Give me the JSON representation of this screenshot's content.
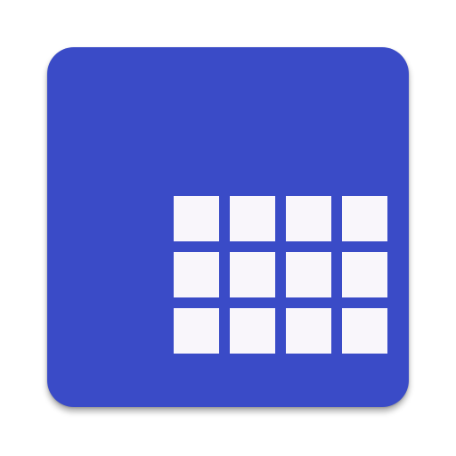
{
  "icon": {
    "name": "grid-app-icon",
    "background_color": "#3a4bc7",
    "tile_color": "#f9f6fb",
    "grid": {
      "rows": 3,
      "columns": 4
    }
  }
}
